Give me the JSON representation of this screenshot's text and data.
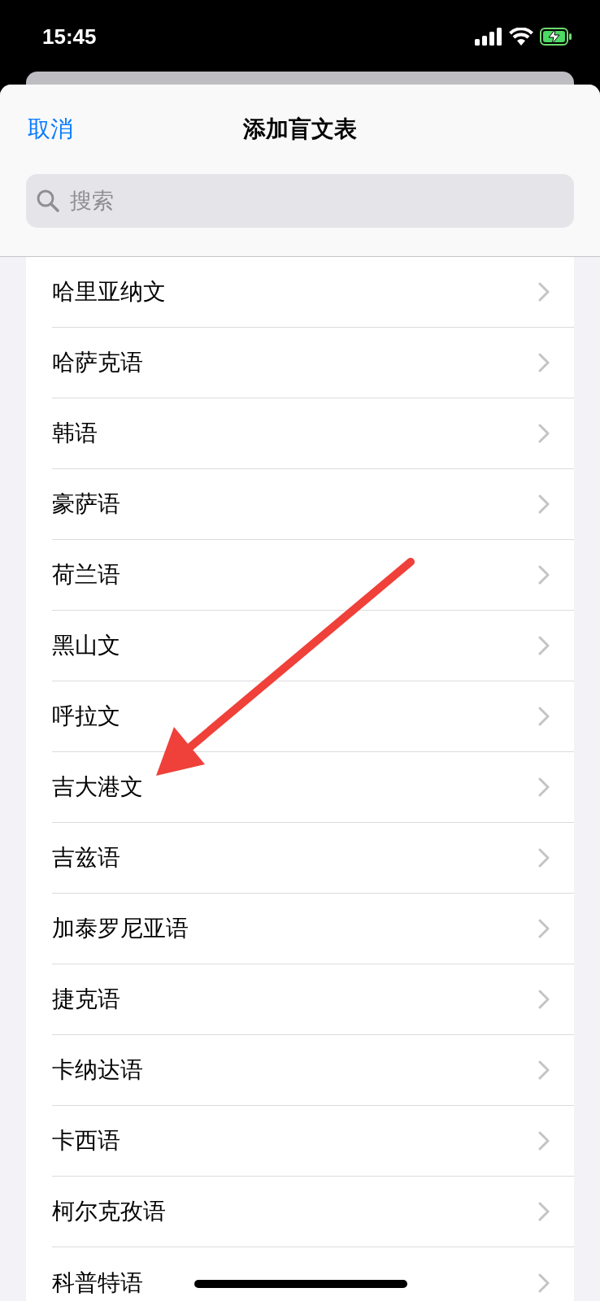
{
  "status_bar": {
    "time": "15:45"
  },
  "nav": {
    "cancel": "取消",
    "title": "添加盲文表"
  },
  "search": {
    "placeholder": "搜索"
  },
  "rows": [
    {
      "label": "哈里亚纳文"
    },
    {
      "label": "哈萨克语"
    },
    {
      "label": "韩语"
    },
    {
      "label": "豪萨语"
    },
    {
      "label": "荷兰语"
    },
    {
      "label": "黑山文"
    },
    {
      "label": "呼拉文"
    },
    {
      "label": "吉大港文"
    },
    {
      "label": "吉兹语"
    },
    {
      "label": "加泰罗尼亚语"
    },
    {
      "label": "捷克语"
    },
    {
      "label": "卡纳达语"
    },
    {
      "label": "卡西语"
    },
    {
      "label": "柯尔克孜语"
    },
    {
      "label": "科普特语"
    }
  ]
}
